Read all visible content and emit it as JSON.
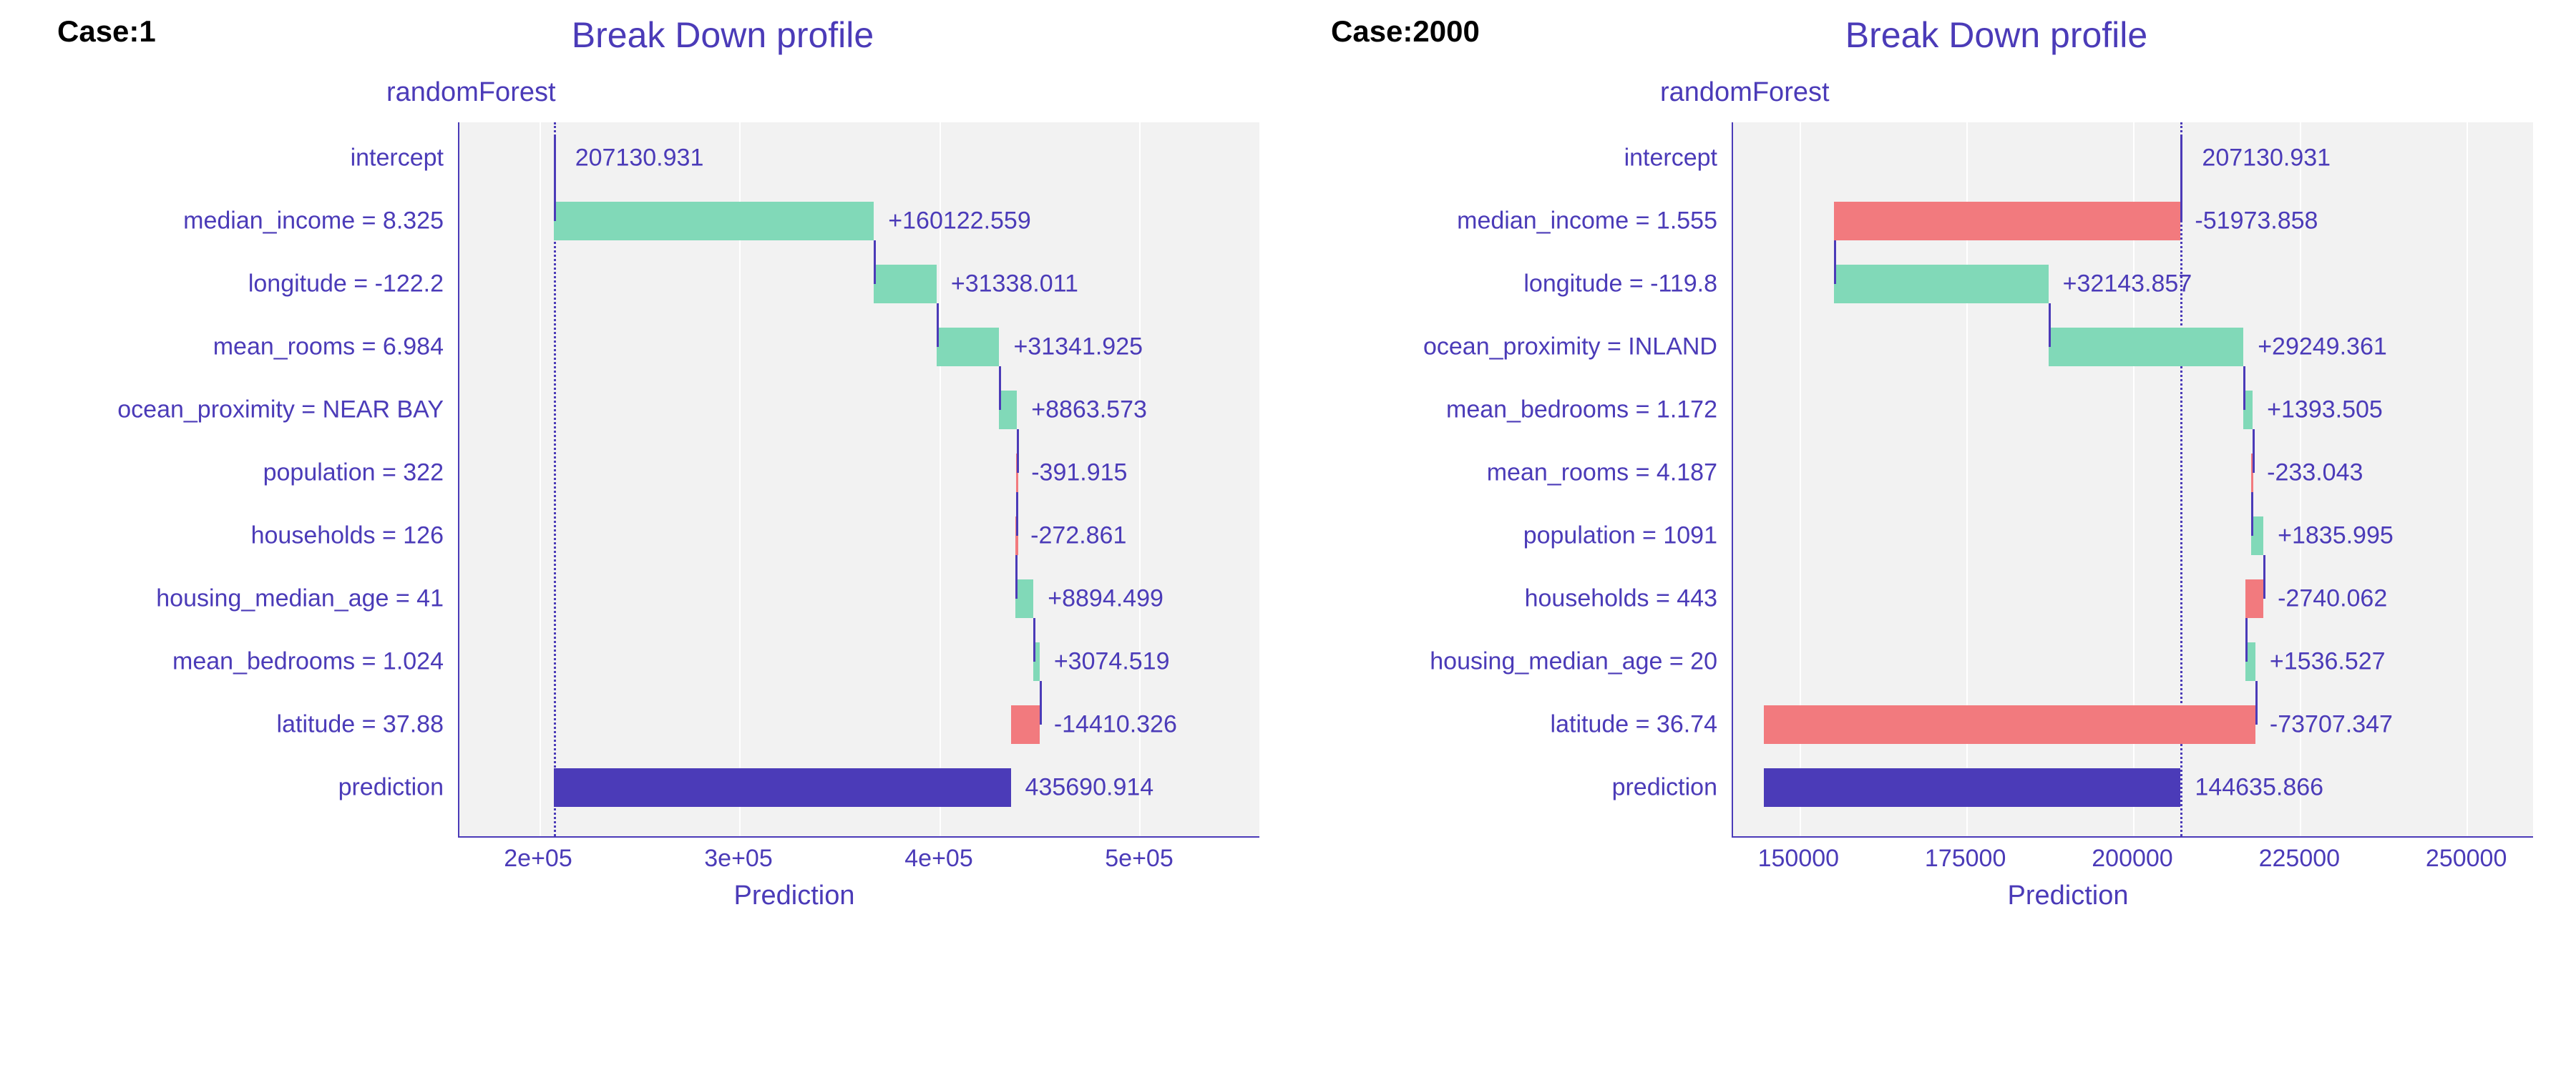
{
  "chart_data": [
    {
      "type": "bar",
      "case": "Case:1",
      "title": "Break Down profile",
      "subtitle": "randomForest",
      "xlabel": "Prediction",
      "x_ticks": [
        "2e+05",
        "3e+05",
        "4e+05",
        "5e+05"
      ],
      "x_tick_vals": [
        200000,
        300000,
        400000,
        500000
      ],
      "x_range": [
        160000,
        560000
      ],
      "intercept": 207130.931,
      "prediction": 435690.914,
      "rows": [
        {
          "label": "intercept",
          "value": "207130.931",
          "type": "intercept",
          "start": 207130.931,
          "end": 207130.931
        },
        {
          "label": "median_income = 8.325",
          "value": "+160122.559",
          "type": "pos",
          "start": 207130.931,
          "end": 367253.49
        },
        {
          "label": "longitude = -122.2",
          "value": "+31338.011",
          "type": "pos",
          "start": 367253.49,
          "end": 398591.501
        },
        {
          "label": "mean_rooms = 6.984",
          "value": "+31341.925",
          "type": "pos",
          "start": 398591.501,
          "end": 429933.426
        },
        {
          "label": "ocean_proximity = NEAR BAY",
          "value": "+8863.573",
          "type": "pos",
          "start": 429933.426,
          "end": 438796.999
        },
        {
          "label": "population = 322",
          "value": "-391.915",
          "type": "neg",
          "start": 438796.999,
          "end": 438405.084
        },
        {
          "label": "households = 126",
          "value": "-272.861",
          "type": "neg",
          "start": 438405.084,
          "end": 438132.223
        },
        {
          "label": "housing_median_age = 41",
          "value": "+8894.499",
          "type": "pos",
          "start": 438132.223,
          "end": 447026.722
        },
        {
          "label": "mean_bedrooms = 1.024",
          "value": "+3074.519",
          "type": "pos",
          "start": 447026.722,
          "end": 450101.241
        },
        {
          "label": "latitude = 37.88",
          "value": "-14410.326",
          "type": "neg",
          "start": 450101.241,
          "end": 435690.915
        },
        {
          "label": "prediction",
          "value": "435690.914",
          "type": "pred",
          "start": 207130.931,
          "end": 435690.914
        }
      ]
    },
    {
      "type": "bar",
      "case": "Case:2000",
      "title": "Break Down profile",
      "subtitle": "randomForest",
      "xlabel": "Prediction",
      "x_ticks": [
        "150000",
        "175000",
        "200000",
        "225000",
        "250000"
      ],
      "x_tick_vals": [
        150000,
        175000,
        200000,
        225000,
        250000
      ],
      "x_range": [
        140000,
        260000
      ],
      "intercept": 207130.931,
      "prediction": 144635.866,
      "rows": [
        {
          "label": "intercept",
          "value": "207130.931",
          "type": "intercept",
          "start": 207130.931,
          "end": 207130.931
        },
        {
          "label": "median_income = 1.555",
          "value": "-51973.858",
          "type": "neg",
          "start": 207130.931,
          "end": 155157.073
        },
        {
          "label": "longitude = -119.8",
          "value": "+32143.857",
          "type": "pos",
          "start": 155157.073,
          "end": 187300.93
        },
        {
          "label": "ocean_proximity = INLAND",
          "value": "+29249.361",
          "type": "pos",
          "start": 187300.93,
          "end": 216550.291
        },
        {
          "label": "mean_bedrooms = 1.172",
          "value": "+1393.505",
          "type": "pos",
          "start": 216550.291,
          "end": 217943.796
        },
        {
          "label": "mean_rooms = 4.187",
          "value": "-233.043",
          "type": "neg",
          "start": 217943.796,
          "end": 217710.753
        },
        {
          "label": "population = 1091",
          "value": "+1835.995",
          "type": "pos",
          "start": 217710.753,
          "end": 219546.748
        },
        {
          "label": "households = 443",
          "value": "-2740.062",
          "type": "neg",
          "start": 219546.748,
          "end": 216806.686
        },
        {
          "label": "housing_median_age = 20",
          "value": "+1536.527",
          "type": "pos",
          "start": 216806.686,
          "end": 218343.213
        },
        {
          "label": "latitude = 36.74",
          "value": "-73707.347",
          "type": "neg",
          "start": 218343.213,
          "end": 144635.866
        },
        {
          "label": "prediction",
          "value": "144635.866",
          "type": "pred",
          "start": 144635.866,
          "end": 207130.931
        }
      ]
    }
  ]
}
